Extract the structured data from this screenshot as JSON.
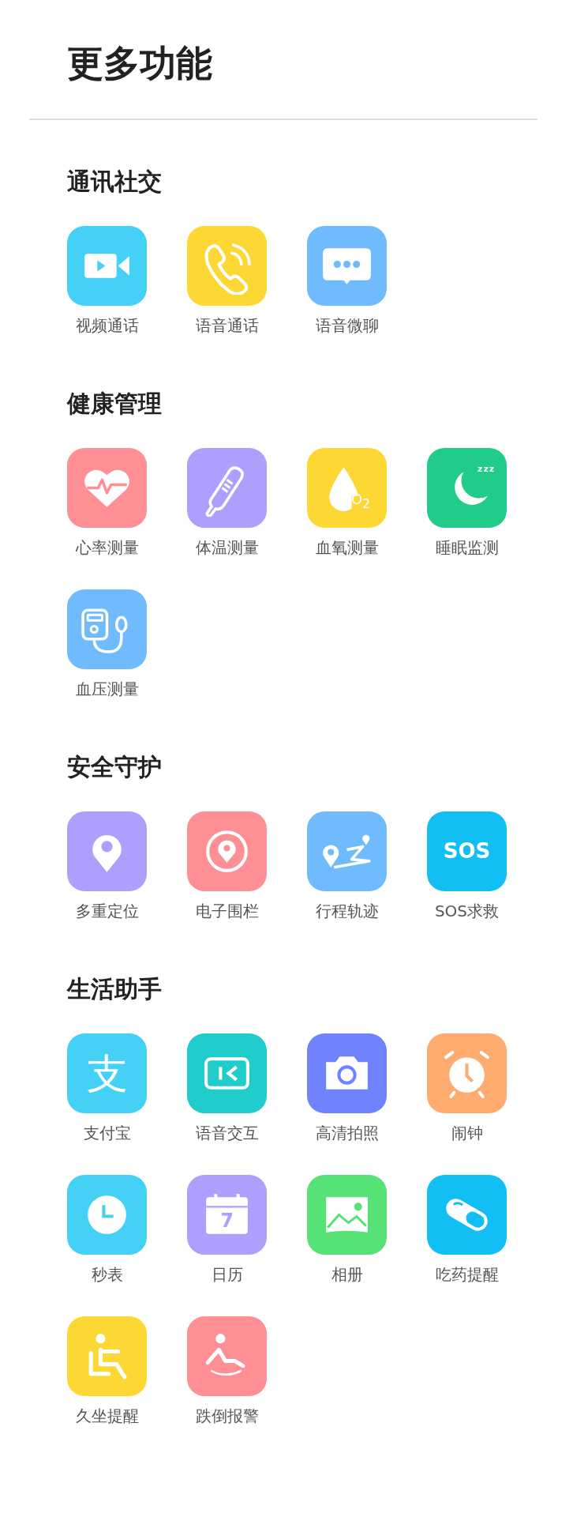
{
  "title": "更多功能",
  "sections": [
    {
      "title": "通讯社交",
      "items": [
        {
          "label": "视频通话",
          "kind": "video",
          "color": "#45d0f6"
        },
        {
          "label": "语音通话",
          "kind": "phone",
          "color": "#fdd835"
        },
        {
          "label": "语音微聊",
          "kind": "chat",
          "color": "#70bbfd"
        }
      ]
    },
    {
      "title": "健康管理",
      "items": [
        {
          "label": "心率测量",
          "kind": "heart",
          "color": "#fe8f95"
        },
        {
          "label": "体温测量",
          "kind": "thermometer",
          "color": "#aca0fc"
        },
        {
          "label": "血氧测量",
          "kind": "oxygen",
          "color": "#fdd835",
          "glyph": "O$_{2}$"
        },
        {
          "label": "睡眠监测",
          "kind": "sleep",
          "color": "#20cc88",
          "glyph": "zzz"
        },
        {
          "label": "血压测量",
          "kind": "pressure",
          "color": "#70bbfd"
        }
      ]
    },
    {
      "title": "安全守护",
      "items": [
        {
          "label": "多重定位",
          "kind": "pin",
          "color": "#aca0fc"
        },
        {
          "label": "电子围栏",
          "kind": "fence",
          "color": "#fe8f95"
        },
        {
          "label": "行程轨迹",
          "kind": "route",
          "color": "#70bbfd"
        },
        {
          "label": "SOS求救",
          "kind": "sos",
          "color": "#12bff5",
          "glyph": "SOS"
        }
      ]
    },
    {
      "title": "生活助手",
      "items": [
        {
          "label": "支付宝",
          "kind": "pay",
          "color": "#45d0f6",
          "glyph": "支"
        },
        {
          "label": "语音交互",
          "kind": "voice",
          "color": "#20cccc"
        },
        {
          "label": "高清拍照",
          "kind": "camera",
          "color": "#7083fe"
        },
        {
          "label": "闹钟",
          "kind": "alarm",
          "color": "#fdab6e"
        },
        {
          "label": "秒表",
          "kind": "clock",
          "color": "#45d0f6"
        },
        {
          "label": "日历",
          "kind": "calendar",
          "color": "#aca0fc",
          "glyph": "7"
        },
        {
          "label": "相册",
          "kind": "photo",
          "color": "#56e276"
        },
        {
          "label": "吃药提醒",
          "kind": "pill",
          "color": "#12bff5"
        },
        {
          "label": "久坐提醒",
          "kind": "sitting",
          "color": "#fdd835"
        },
        {
          "label": "跌倒报警",
          "kind": "fall",
          "color": "#fe8f95"
        }
      ]
    }
  ]
}
